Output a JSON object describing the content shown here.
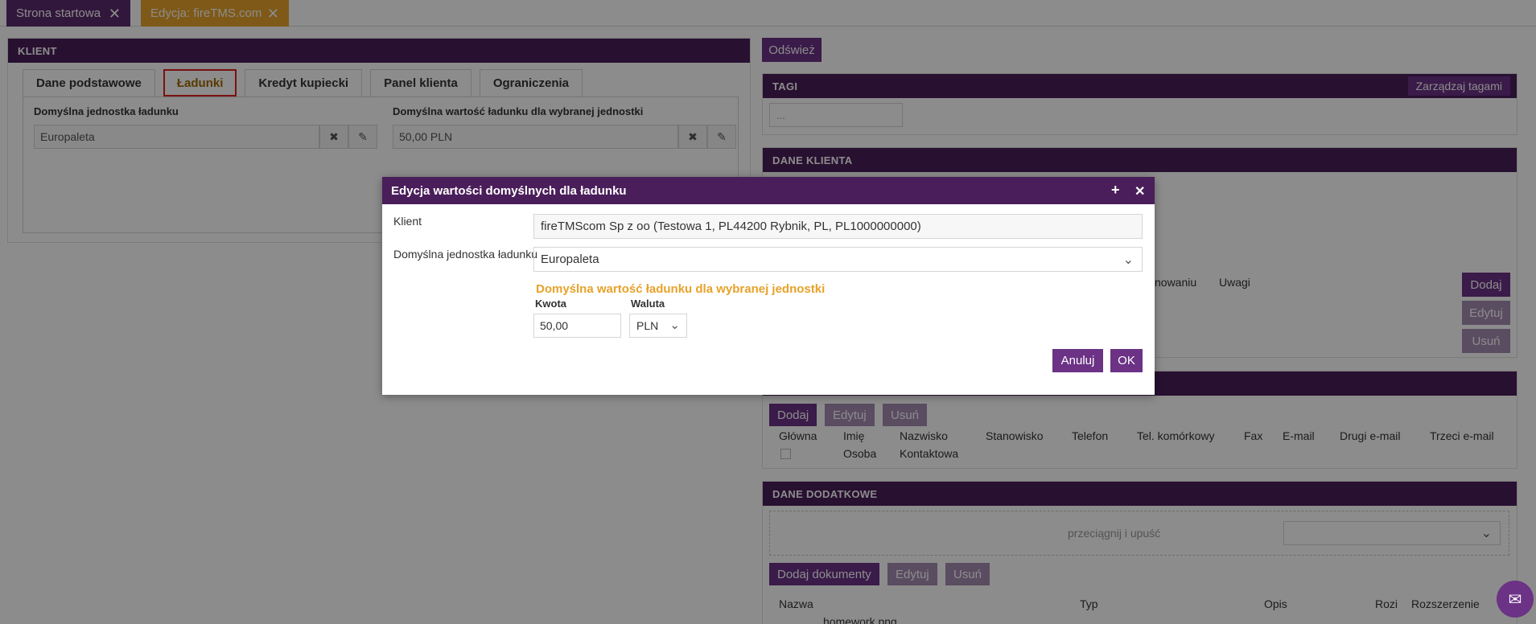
{
  "tabs": [
    {
      "label": "Strona startowa",
      "close": "✕"
    },
    {
      "label": "Edycja: fireTMS.com",
      "close": "✕"
    }
  ],
  "client_panel": {
    "title": "KLIENT",
    "subtabs": [
      "Dane podstawowe",
      "Ładunki",
      "Kredyt kupiecki",
      "Panel klienta",
      "Ograniczenia"
    ],
    "unit_label": "Domyślna jednostka ładunku",
    "unit_value": "Europaleta",
    "value_label": "Domyślna wartość ładunku dla wybranej jednostki",
    "value_value": "50,00 PLN"
  },
  "right": {
    "refresh_label": "Odśwież",
    "tags": {
      "title": "TAGI",
      "manage_label": "Zarządzaj tagami",
      "input_value": "..."
    },
    "client_data": {
      "title": "DANE KLIENTA"
    },
    "notes_row": {
      "col_partial": "nowaniu",
      "col_notes": "Uwagi",
      "add": "Dodaj",
      "edit": "Edytuj",
      "delete": "Usuń"
    },
    "contacts": {
      "add": "Dodaj",
      "edit": "Edytuj",
      "delete": "Usuń",
      "columns": [
        "Główna",
        "Imię",
        "Nazwisko",
        "Stanowisko",
        "Telefon",
        "Tel. komórkowy",
        "Fax",
        "E-mail",
        "Drugi e-mail",
        "Trzeci e-mail"
      ],
      "sub_labels": [
        "Osoba",
        "Kontaktowa"
      ]
    },
    "extra": {
      "title": "DANE DODATKOWE",
      "drop_text": "przeciągnij i upuść",
      "add_docs": "Dodaj dokumenty",
      "edit": "Edytuj",
      "delete": "Usuń",
      "columns": [
        "Nazwa",
        "Typ",
        "Opis",
        "Rozi",
        "Rozszerzenie"
      ],
      "file_name": "homework.png"
    }
  },
  "dialog": {
    "title": "Edycja wartości domyślnych dla ładunku",
    "plus": "+",
    "close": "✕",
    "client_label": "Klient",
    "client_value": "fireTMScom Sp z oo (Testowa 1, PL44200 Rybnik, PL, PL1000000000)",
    "unit_label": "Domyślna jednostka ładunku",
    "unit_value": "Europaleta",
    "section_title": "Domyślna wartość ładunku dla wybranej jednostki",
    "amount_label": "Kwota",
    "amount_value": "50,00",
    "currency_label": "Waluta",
    "currency_value": "PLN",
    "cancel_label": "Anuluj",
    "ok_label": "OK"
  }
}
